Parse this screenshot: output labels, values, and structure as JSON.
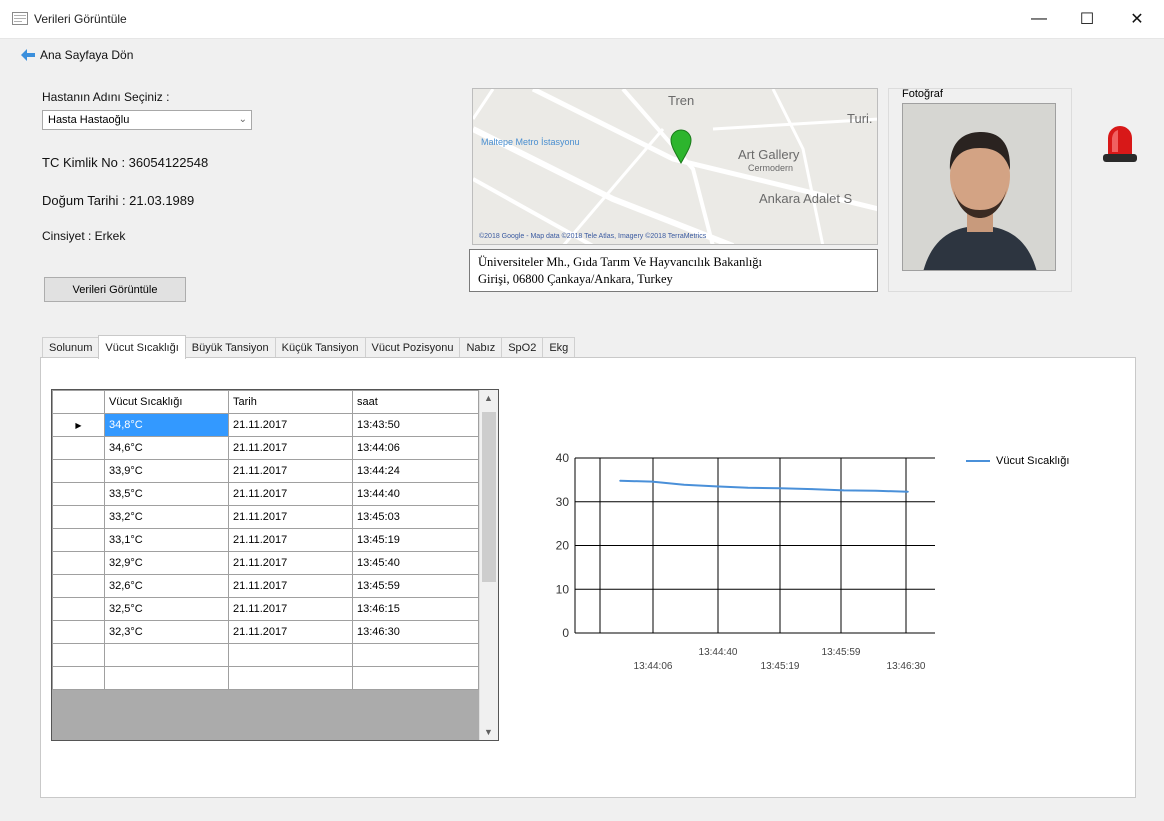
{
  "window": {
    "title": "Verileri Görüntüle",
    "min_glyph": "—",
    "max_glyph": "☐",
    "close_glyph": "✕"
  },
  "nav": {
    "back_label": "Ana Sayfaya Dön"
  },
  "patient": {
    "select_label": "Hastanın Adını Seçiniz :",
    "selected_name": "Hasta Hastaoğlu",
    "tc_line": "TC Kimlik No : 36054122548",
    "dob_line": "Doğum Tarihi : 21.03.1989",
    "gender_line": "Cinsiyet : Erkek",
    "view_button": "Verileri Görüntüle"
  },
  "map": {
    "labels": [
      "Tren",
      "Turi.",
      "Maltepe Metro İstasyonu",
      "Art Gallery",
      "Cermodern",
      "Ankara Adalet S"
    ],
    "attribution": "©2018 Google - Map data ©2018 Tele Atlas, Imagery ©2018 TerraMetrics",
    "address_line1": "Üniversiteler Mh., Gıda Tarım Ve Hayvancılık Bakanlığı",
    "address_line2": "Girişi, 06800 Çankaya/Ankara, Turkey"
  },
  "photo": {
    "label": "Fotoğraf"
  },
  "tabs": [
    "Solunum",
    "Vücut Sıcaklığı",
    "Büyük Tansiyon",
    "Küçük Tansiyon",
    "Vücut Pozisyonu",
    "Nabız",
    "SpO2",
    "Ekg"
  ],
  "active_tab_index": 1,
  "grid": {
    "columns": [
      "Vücut Sıcaklığı",
      "Tarih",
      "saat"
    ],
    "rows": [
      [
        "34,8°C",
        "21.11.2017",
        "13:43:50"
      ],
      [
        "34,6°C",
        "21.11.2017",
        "13:44:06"
      ],
      [
        "33,9°C",
        "21.11.2017",
        "13:44:24"
      ],
      [
        "33,5°C",
        "21.11.2017",
        "13:44:40"
      ],
      [
        "33,2°C",
        "21.11.2017",
        "13:45:03"
      ],
      [
        "33,1°C",
        "21.11.2017",
        "13:45:19"
      ],
      [
        "32,9°C",
        "21.11.2017",
        "13:45:40"
      ],
      [
        "32,6°C",
        "21.11.2017",
        "13:45:59"
      ],
      [
        "32,5°C",
        "21.11.2017",
        "13:46:15"
      ],
      [
        "32,3°C",
        "21.11.2017",
        "13:46:30"
      ]
    ],
    "selected_row": 0,
    "row_indicator": "▶"
  },
  "chart_data": {
    "type": "line",
    "x": [
      "13:43:50",
      "13:44:06",
      "13:44:24",
      "13:44:40",
      "13:45:03",
      "13:45:19",
      "13:45:40",
      "13:45:59",
      "13:46:15",
      "13:46:30"
    ],
    "series": [
      {
        "name": "Vücut Sıcaklığı",
        "values": [
          34.8,
          34.6,
          33.9,
          33.5,
          33.2,
          33.1,
          32.9,
          32.6,
          32.5,
          32.3
        ]
      }
    ],
    "ylim": [
      0,
      40
    ],
    "yticks": [
      0,
      10,
      20,
      30,
      40
    ],
    "xtick_labels_lower": [
      "13:44:06",
      "13:45:19",
      "13:46:30"
    ],
    "xtick_labels_upper": [
      "13:44:40",
      "13:45:59"
    ],
    "grid": true,
    "legend": "right",
    "line_color": "#4a90d9"
  }
}
